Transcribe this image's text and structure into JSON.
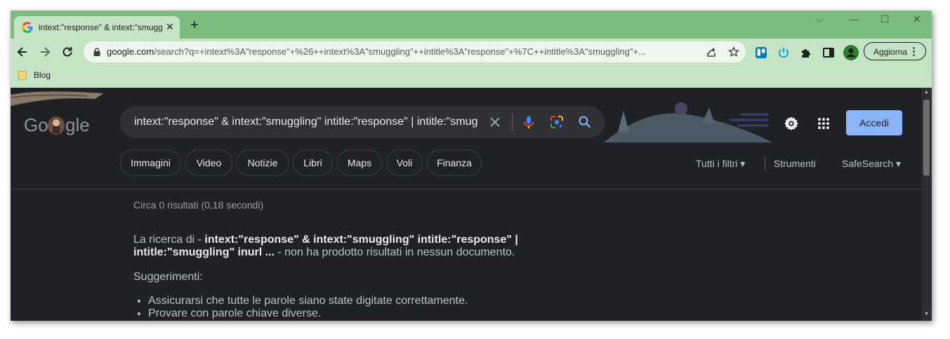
{
  "tab": {
    "title": "intext:\"response\" & intext:\"smuggling\"",
    "close_glyph": "✕"
  },
  "newtab_glyph": "+",
  "window_controls": {
    "dropdown": "⌵",
    "minimize": "—",
    "maximize": "☐",
    "close": "✕"
  },
  "address": {
    "domain": "google.com",
    "path": "/search?q=+intext%3A\"response\"+%26++intext%3A\"smuggling\"++intitle%3A\"response\"+%7C++intitle%3A\"smuggling\"+..."
  },
  "update_button": {
    "label": "Aggiorna",
    "menu": "⋮"
  },
  "bookmarks": [
    {
      "label": "Blog"
    }
  ],
  "search": {
    "query": "intext:\"response\" &  intext:\"smuggling\"  intitle:\"response\" |  intitle:\"smuggling\""
  },
  "signin_label": "Accedi",
  "chips": [
    "Immagini",
    "Video",
    "Notizie",
    "Libri",
    "Maps",
    "Voli",
    "Finanza"
  ],
  "filters": {
    "all_filters": "Tutti i filtri ▾",
    "tools": "Strumenti",
    "safesearch": "SafeSearch ▾"
  },
  "results": {
    "stats": "Circa 0 risultati (0,18 secondi)",
    "no_results_prefix": "La ricerca di - ",
    "no_results_query": "intext:\"response\" & intext:\"smuggling\" intitle:\"response\" | intitle:\"smuggling\" inurl ...",
    "no_results_suffix": " - non ha prodotto risultati in nessun documento.",
    "suggestions_title": "Suggerimenti:",
    "suggestions": [
      "Assicurarsi che tutte le parole siano state digitate correttamente.",
      "Provare con parole chiave diverse."
    ]
  },
  "colors": {
    "tabstrip": "#7cbc7f",
    "toolbar": "#c5e3c5",
    "page_bg": "#202124",
    "signin_button": "#8ab4f8"
  }
}
